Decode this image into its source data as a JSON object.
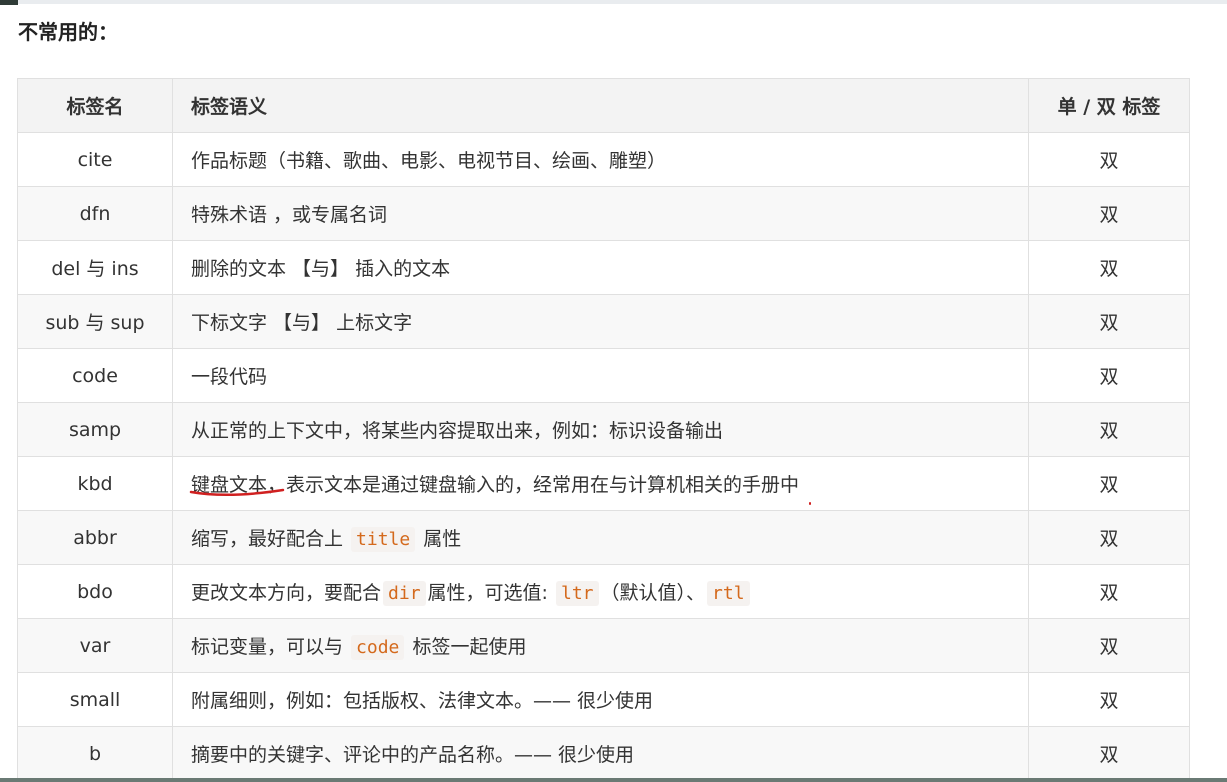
{
  "section": {
    "title": "不常用的："
  },
  "table": {
    "headers": {
      "name": "标签名",
      "meaning": "标签语义",
      "pair": "单 / 双 标签"
    },
    "rows": [
      {
        "name": "cite",
        "meaning": "作品标题（书籍、歌曲、电影、电视节目、绘画、雕塑）",
        "pair": "双"
      },
      {
        "name": "dfn",
        "meaning": "特殊术语 ，或专属名词",
        "pair": "双"
      },
      {
        "name": "del 与 ins",
        "meaning": "删除的文本 【与】 插入的文本",
        "pair": "双"
      },
      {
        "name": "sub 与 sup",
        "meaning": "下标文字 【与】 上标文字",
        "pair": "双"
      },
      {
        "name": "code",
        "meaning": "一段代码",
        "pair": "双"
      },
      {
        "name": "samp",
        "meaning": "从正常的上下文中，将某些内容提取出来，例如：标识设备输出",
        "pair": "双"
      },
      {
        "name": "kbd",
        "meaning_highlight": "键盘文本",
        "meaning_rest": "，表示文本是通过键盘输入的，经常用在与计算机相关的手册中",
        "pair": "双"
      },
      {
        "name": "abbr",
        "meaning_a": "缩写，最好配合上 ",
        "code1": "title",
        "meaning_b": " 属性",
        "pair": "双"
      },
      {
        "name": "bdo",
        "meaning_a": "更改文本方向，要配合",
        "code1": "dir",
        "meaning_b": "属性，可选值: ",
        "code2": "ltr",
        "meaning_c": "（默认值）、",
        "code3": "rtl",
        "pair": "双"
      },
      {
        "name": "var",
        "meaning_a": "标记变量，可以与 ",
        "code1": "code",
        "meaning_b": " 标签一起使用",
        "pair": "双"
      },
      {
        "name": "small",
        "meaning": "附属细则，例如：包括版权、法律文本。—— 很少使用",
        "pair": "双"
      },
      {
        "name": "b",
        "meaning": "摘要中的关键字、评论中的产品名称。—— 很少使用",
        "pair": "双"
      }
    ]
  },
  "colors": {
    "code_text": "#d4691c",
    "annotation_red": "#d02020"
  }
}
